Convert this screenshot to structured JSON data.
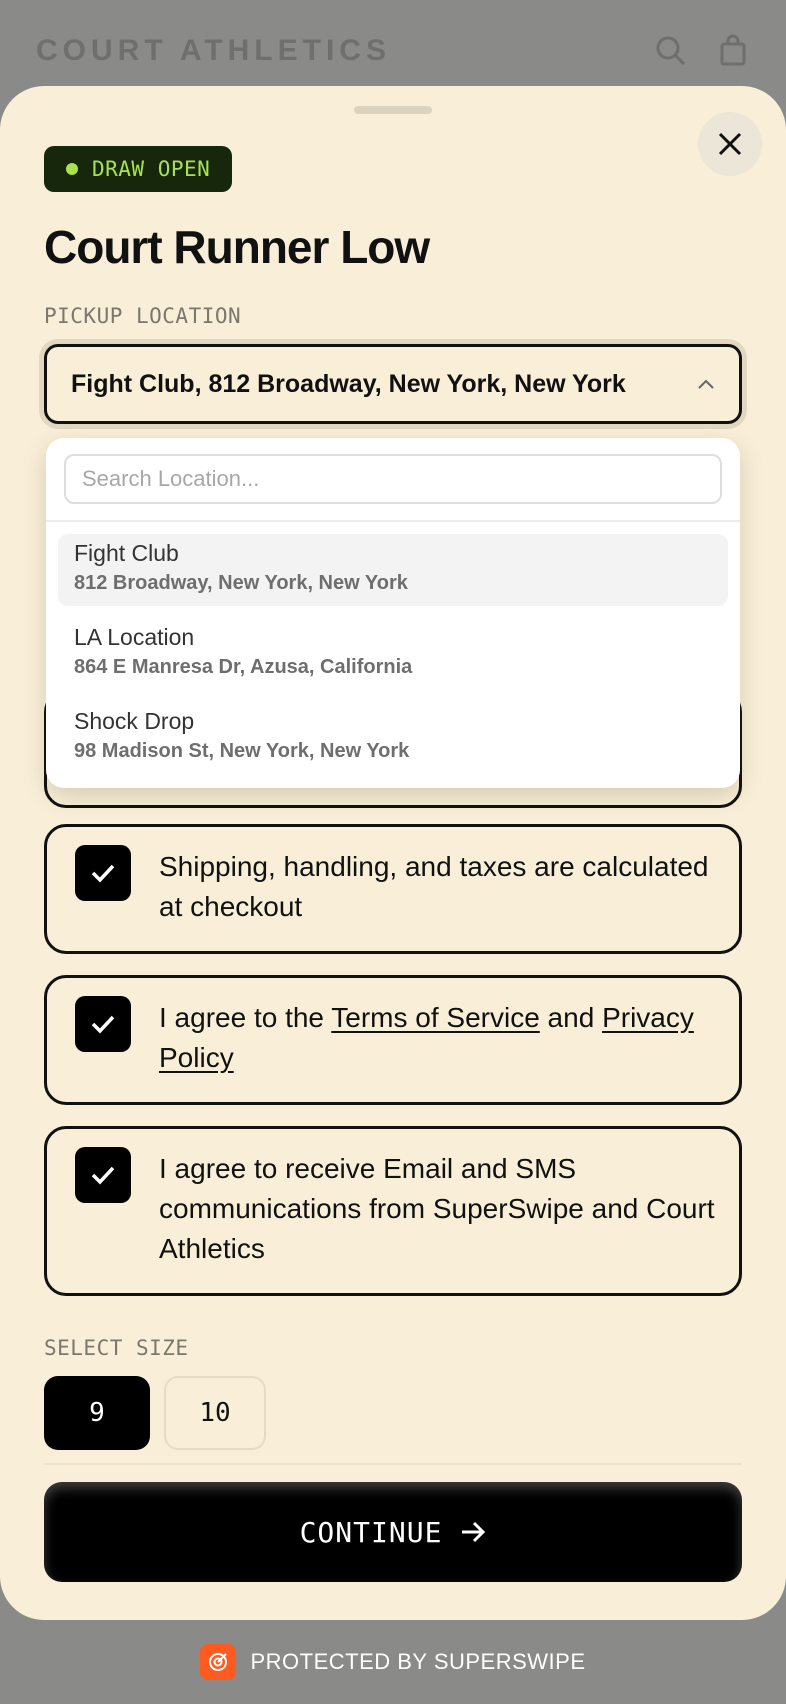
{
  "background": {
    "brand": "COURT ATHLETICS",
    "icons": [
      "search-icon",
      "bag-icon"
    ]
  },
  "sheet": {
    "badge": "DRAW OPEN",
    "title": "Court Runner Low",
    "close_icon": "close-icon"
  },
  "pickup": {
    "label": "PICKUP LOCATION",
    "selected": "Fight Club, 812 Broadway, New York, New York",
    "search_placeholder": "Search Location...",
    "options": [
      {
        "name": "Fight Club",
        "address": "812 Broadway, New York, New York",
        "active": true
      },
      {
        "name": "LA Location",
        "address": "864 E Manresa Dr, Azusa, California",
        "active": false
      },
      {
        "name": "Shock Drop",
        "address": "98 Madison St, New York, New York",
        "active": false
      }
    ]
  },
  "agreements": {
    "shipping": "Shipping, handling, and taxes are calculated at checkout",
    "terms_prefix": "I agree to the ",
    "terms_link": "Terms of Service",
    "terms_mid": " and ",
    "privacy_link": "Privacy Policy",
    "marketing": "I agree to receive Email and SMS communications from SuperSwipe and Court Athletics",
    "checked": [
      true,
      true,
      true
    ]
  },
  "size": {
    "label": "SELECT SIZE",
    "options": [
      "9",
      "10"
    ],
    "selected": "9"
  },
  "cta": {
    "label": "CONTINUE"
  },
  "footer": {
    "text": "PROTECTED BY SUPERSWIPE"
  },
  "colors": {
    "sheet_bg": "#f9efd8",
    "badge_bg": "#17270b",
    "badge_fg": "#a9e24f",
    "footer_logo": "#ff5a1f"
  }
}
